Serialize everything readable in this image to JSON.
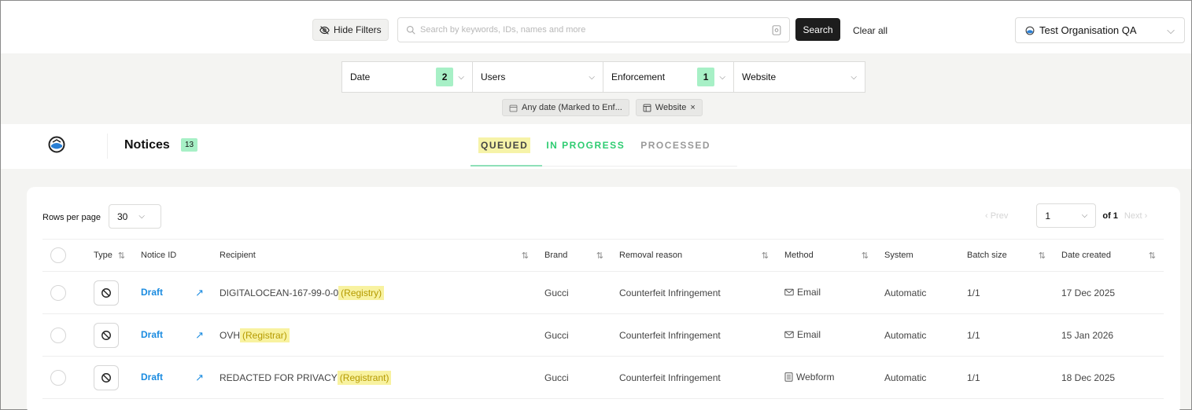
{
  "topbar": {
    "hide_filters_label": "Hide Filters",
    "search_placeholder": "Search by keywords, IDs, names and more",
    "search_button": "Search",
    "clear_all": "Clear all",
    "organisation": "Test Organisation QA"
  },
  "filters": {
    "dropdowns": [
      {
        "label": "Date",
        "count": "2"
      },
      {
        "label": "Users",
        "count": ""
      },
      {
        "label": "Enforcement",
        "count": "1"
      },
      {
        "label": "Website",
        "count": ""
      }
    ],
    "chips": [
      {
        "label": "Any date (Marked to Enf...",
        "icon": "calendar-icon"
      },
      {
        "label": "Website",
        "icon": "website-icon",
        "close": "×"
      }
    ]
  },
  "page": {
    "title": "Notices",
    "count": "13",
    "tabs": [
      {
        "label": "QUEUED",
        "active": true
      },
      {
        "label": "IN PROGRESS",
        "active": false
      },
      {
        "label": "PROCESSED",
        "active": false
      }
    ]
  },
  "table_controls": {
    "rows_label": "Rows per page",
    "rows_value": "30",
    "prev": "‹ Prev",
    "next": "Next ›",
    "page_value": "1",
    "of_label": "of 1"
  },
  "table": {
    "columns": [
      "Type",
      "Notice ID",
      "Recipient",
      "Brand",
      "Removal reason",
      "Method",
      "System",
      "Batch size",
      "Date created"
    ],
    "rows": [
      {
        "notice_id": "Draft",
        "recipient": "DIGITALOCEAN-167-99-0-0",
        "recipient_role": "(Registry)",
        "brand": "Gucci",
        "removal_reason": "Counterfeit Infringement",
        "method": "Email",
        "method_icon": "mail-icon",
        "system": "Automatic",
        "batch_size": "1/1",
        "date_created": "17 Dec 2025"
      },
      {
        "notice_id": "Draft",
        "recipient": "OVH",
        "recipient_role": "(Registrar)",
        "brand": "Gucci",
        "removal_reason": "Counterfeit Infringement",
        "method": "Email",
        "method_icon": "mail-icon",
        "system": "Automatic",
        "batch_size": "1/1",
        "date_created": "15 Jan 2026"
      },
      {
        "notice_id": "Draft",
        "recipient": "REDACTED FOR PRIVACY",
        "recipient_role": "(Registrant)",
        "brand": "Gucci",
        "removal_reason": "Counterfeit Infringement",
        "method": "Webform",
        "method_icon": "webform-icon",
        "system": "Automatic",
        "batch_size": "1/1",
        "date_created": "18 Dec 2025"
      }
    ]
  },
  "colors": {
    "accent_green": "#a7f0c6",
    "highlight_yellow": "#f8f2a0",
    "link_blue": "#1a8be0",
    "in_progress_green": "#2ecc71"
  }
}
